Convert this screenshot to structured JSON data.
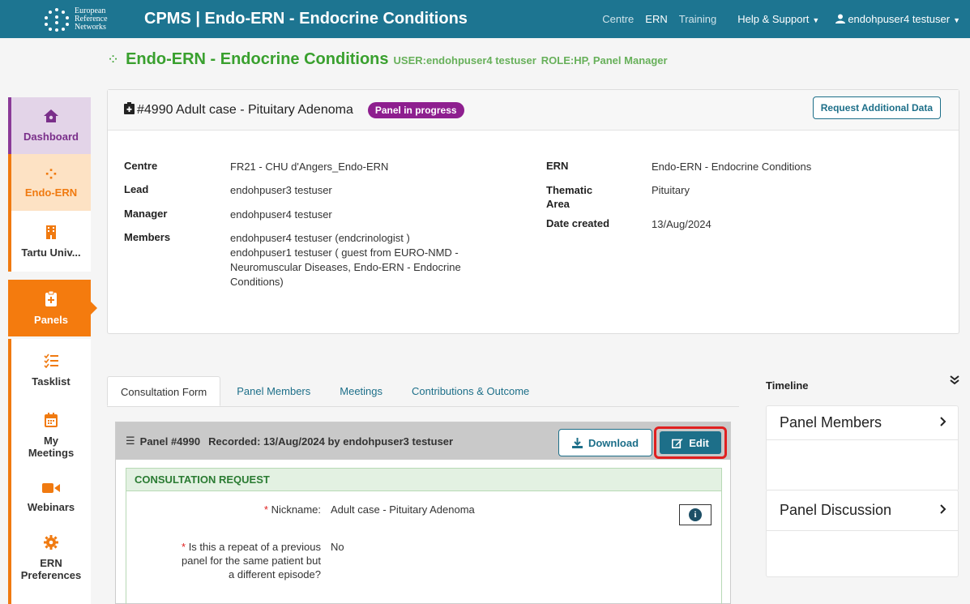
{
  "topbar": {
    "logo_lines": [
      "European",
      "Reference",
      "Networks"
    ],
    "app_title": "CPMS | Endo-ERN - Endocrine Conditions",
    "nav": [
      {
        "label": "Centre"
      },
      {
        "label": "ERN"
      },
      {
        "label": "Training"
      },
      {
        "label": "Help & Support"
      },
      {
        "label": "endohpuser4 testuser"
      }
    ],
    "user_icon": "user-icon"
  },
  "heading": {
    "title": "Endo-ERN - Endocrine Conditions",
    "user": "USER:endohpuser4 testuser",
    "role": "ROLE:HP, Panel Manager"
  },
  "sidebar": {
    "items": [
      {
        "label": "Dashboard",
        "icon": "home-icon"
      },
      {
        "label": "Endo-ERN",
        "icon": "network-icon"
      },
      {
        "label": "Tartu Univ...",
        "icon": "building-icon"
      },
      {
        "label": "Panels",
        "icon": "clipboard-icon"
      },
      {
        "label": "Tasklist",
        "icon": "tasklist-icon"
      },
      {
        "label": "My Meetings",
        "icon": "calendar-icon"
      },
      {
        "label": "Webinars",
        "icon": "video-icon"
      },
      {
        "label": "ERN Preferences",
        "icon": "gear-icon"
      }
    ]
  },
  "case": {
    "title": "#4990 Adult case - Pituitary Adenoma",
    "status": "Panel in progress",
    "request_button": "Request Additional Data",
    "left": [
      {
        "label": "Centre",
        "value": "FR21 - CHU d'Angers_Endo-ERN"
      },
      {
        "label": "Lead",
        "value": "endohpuser3 testuser"
      },
      {
        "label": "Manager",
        "value": "endohpuser4 testuser"
      },
      {
        "label": "Members",
        "lines": [
          "endohpuser4 testuser (endcrinologist )",
          "endohpuser1 testuser ( guest from EURO-NMD -",
          "Neuromuscular Diseases, Endo-ERN - Endocrine",
          "Conditions)"
        ]
      }
    ],
    "right": [
      {
        "label": "ERN",
        "value": "Endo-ERN - Endocrine Conditions"
      },
      {
        "label_lines": [
          "Thematic",
          "Area"
        ],
        "value": "Pituitary"
      },
      {
        "label": "Date created",
        "value": "13/Aug/2024"
      }
    ]
  },
  "tabs": [
    {
      "label": "Consultation Form",
      "active": true
    },
    {
      "label": "Panel Members"
    },
    {
      "label": "Meetings"
    },
    {
      "label": "Contributions & Outcome"
    }
  ],
  "panel": {
    "title": "Panel #4990",
    "recorded": "Recorded: 13/Aug/2024 by endohpuser3 testuser",
    "download_label": "Download",
    "edit_label": "Edit",
    "section_title": "CONSULTATION REQUEST",
    "fields": [
      {
        "question_lines": [
          "Nickname:"
        ],
        "answer": "Adult case - Pituitary Adenoma"
      },
      {
        "question_lines": [
          "Is this a repeat of a previous",
          "panel for the same patient but",
          "a different episode?"
        ],
        "answer": "No"
      }
    ],
    "required_mark": "*"
  },
  "timeline": {
    "title": "Timeline",
    "cards": [
      {
        "label": "Panel Members"
      },
      {
        "label": "Panel Discussion"
      }
    ]
  }
}
